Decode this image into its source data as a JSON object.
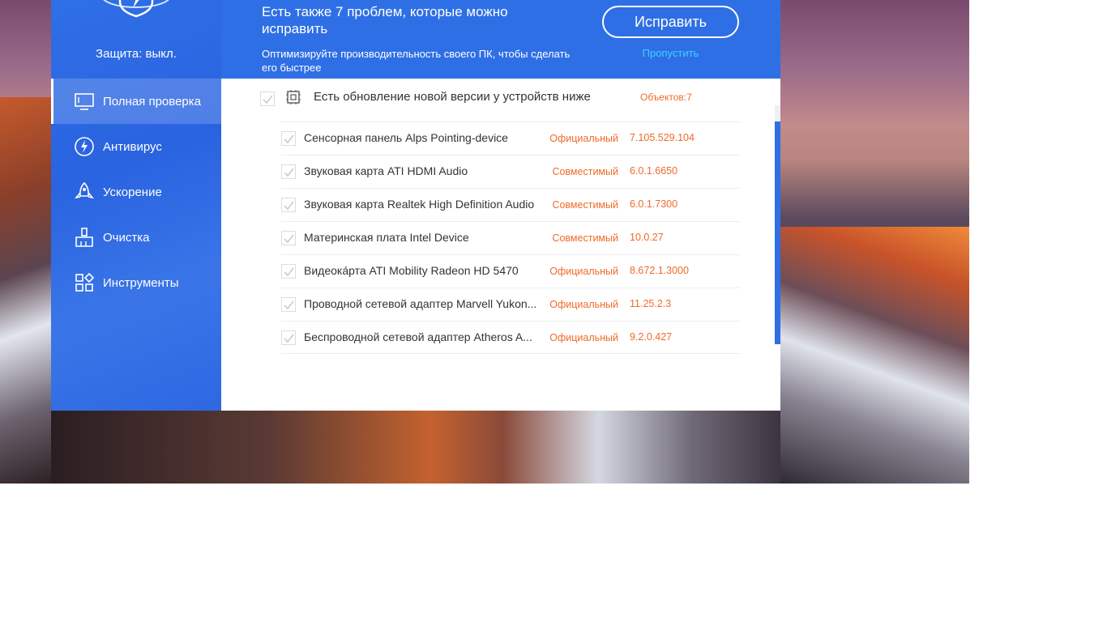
{
  "sidebar": {
    "protection_status": "Защита: выкл.",
    "items": [
      {
        "label": "Полная проверка",
        "icon": "monitor-icon"
      },
      {
        "label": "Антивирус",
        "icon": "bolt-circle-icon"
      },
      {
        "label": "Ускорение",
        "icon": "rocket-icon"
      },
      {
        "label": "Очистка",
        "icon": "broom-icon"
      },
      {
        "label": "Инструменты",
        "icon": "grid-tools-icon"
      }
    ]
  },
  "banner": {
    "title": "Есть также 7 проблем, которые можно исправить",
    "subtitle": "Оптимизируйте производительность своего ПК, чтобы сделать его быстрее",
    "fix_label": "Исправить",
    "skip_label": "Пропустить"
  },
  "group": {
    "title": "Есть обновление новой версии у устройств ниже",
    "count": "Объектов:7"
  },
  "drivers": [
    {
      "name": "Сенсорная панель Alps Pointing-device",
      "status": "Официальный",
      "version": "7.105.529.104"
    },
    {
      "name": "Звуковая карта ATI HDMI Audio",
      "status": "Совместимый",
      "version": "6.0.1.6650"
    },
    {
      "name": "Звуковая карта Realtek High Definition Audio",
      "status": "Совместимый",
      "version": "6.0.1.7300"
    },
    {
      "name": "Материнская плата Intel Device",
      "status": "Совместимый",
      "version": "10.0.27"
    },
    {
      "name": "Видеока́рта ATI Mobility Radeon HD 5470",
      "status": "Официальный",
      "version": "8.672.1.3000"
    },
    {
      "name": "Проводной сетевой адаптер Marvell Yukon...",
      "status": "Официальный",
      "version": "11.25.2.3"
    },
    {
      "name": "Беспроводной сетевой адаптер Atheros A...",
      "status": "Официальный",
      "version": "9.2.0.427"
    }
  ],
  "colors": {
    "accent": "#2f6fe6",
    "warning_text": "#f06a2a",
    "link": "#3fd0ff"
  }
}
